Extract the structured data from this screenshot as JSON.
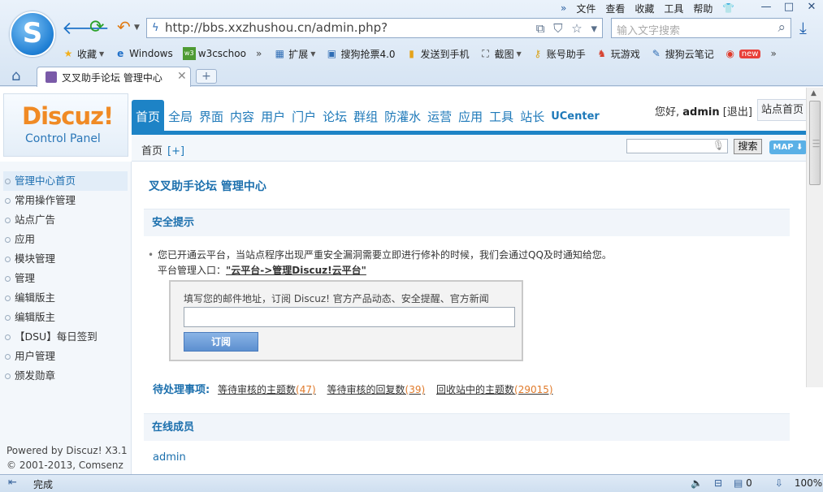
{
  "browser": {
    "logo_glyph": "S",
    "top_menu": [
      "文件",
      "查看",
      "收藏",
      "工具",
      "帮助"
    ],
    "top_menu_icons": [
      "chevron-double-right-icon",
      "shirt-icon"
    ],
    "window_controls": [
      "—",
      "□",
      "✕"
    ],
    "url": "http://bbs.xxzhushou.cn/admin.php?",
    "search_placeholder": "输入文字搜索",
    "favorites": [
      {
        "label": "收藏",
        "icon": "star-icon"
      },
      {
        "label": "Windows",
        "icon": "ie-icon"
      },
      {
        "label": "w3cschoo",
        "icon": "w3c-icon"
      },
      {
        "label": "扩展",
        "icon": "grid-icon"
      },
      {
        "label": "搜狗抢票4.0",
        "icon": "ticket-icon"
      },
      {
        "label": "发送到手机",
        "icon": "phone-icon"
      },
      {
        "label": "截图",
        "icon": "screenshot-icon"
      },
      {
        "label": "账号助手",
        "icon": "key-icon"
      },
      {
        "label": "玩游戏",
        "icon": "game-icon"
      },
      {
        "label": "搜狗云笔记",
        "icon": "note-icon"
      },
      {
        "label": "new",
        "icon": "weibo-icon"
      }
    ],
    "tab_title": "叉叉助手论坛 管理中心",
    "status_text": "完成",
    "status_badge": "0",
    "zoom": "100%"
  },
  "header": {
    "logo_title": "Discuz!",
    "logo_subtitle": "Control Panel",
    "nav": [
      "首页",
      "全局",
      "界面",
      "内容",
      "用户",
      "门户",
      "论坛",
      "群组",
      "防灌水",
      "运营",
      "应用",
      "工具",
      "站长",
      "UCenter"
    ],
    "greeting": "您好,",
    "username": "admin",
    "logout": "[退出]",
    "site_home": "站点首页",
    "breadcrumb": "首页",
    "breadcrumb_add": "[+]",
    "search_button": "搜索",
    "map_button": "MAP"
  },
  "sidebar": {
    "items": [
      "管理中心首页",
      "常用操作管理",
      "站点广告",
      "应用",
      "模块管理",
      "管理",
      "编辑版主",
      "编辑版主",
      "【DSU】每日签到",
      "用户管理",
      "颁发勋章"
    ],
    "powered": "Powered by Discuz! X3.1",
    "copyright": "© 2001-2013, Comsenz Inc."
  },
  "content": {
    "title": "叉叉助手论坛 管理中心",
    "security_heading": "安全提示",
    "security_text": "您已开通云平台，当站点程序出现严重安全漏洞需要立即进行修补的时候，我们会通过QQ及时通知给您。",
    "platform_entry": "平台管理入口：",
    "platform_link": "\"云平台->管理Discuz!云平台\"",
    "subscribe_label": "填写您的邮件地址，订阅 Discuz! 官方产品动态、安全提醒、官方新闻",
    "subscribe_value": "",
    "subscribe_button": "订阅",
    "pending_label": "待处理事项:",
    "pending": [
      {
        "label": "等待审核的主题数",
        "count": "(47)"
      },
      {
        "label": "等待审核的回复数",
        "count": "(39)"
      },
      {
        "label": "回收站中的主题数",
        "count": "(29015)"
      }
    ],
    "online_heading": "在线成员",
    "online_user": "admin"
  }
}
